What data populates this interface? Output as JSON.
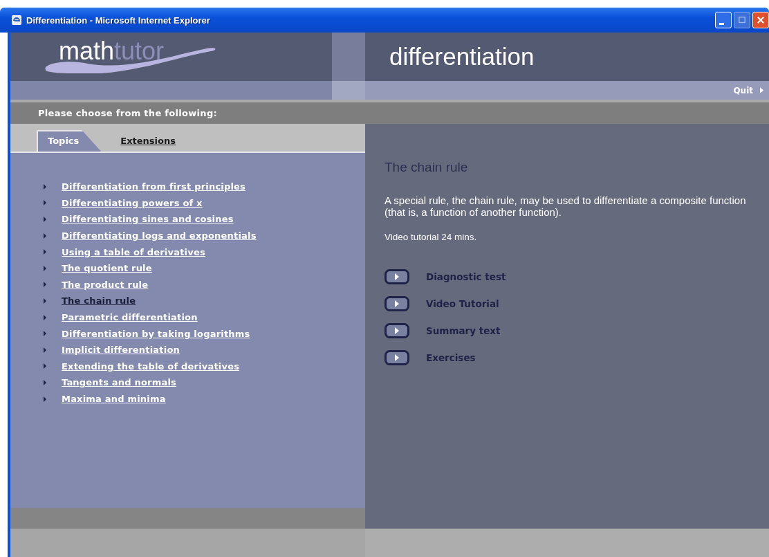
{
  "window": {
    "title": "Differentiation - Microsoft Internet Explorer"
  },
  "logo": {
    "part_1": "math",
    "part_2": "tutor"
  },
  "header": {
    "title": "differentiation",
    "quit": "Quit"
  },
  "prompt": "Please choose from the following:",
  "tabs": [
    {
      "label": "Topics",
      "selected": true
    },
    {
      "label": "Extensions",
      "selected": false
    }
  ],
  "topics": [
    {
      "label": "Differentiation from first principles",
      "selected": false
    },
    {
      "label": "Differentiating powers of x",
      "selected": false
    },
    {
      "label": "Differentiating sines and cosines",
      "selected": false
    },
    {
      "label": "Differentiating logs and exponentials",
      "selected": false
    },
    {
      "label": "Using a table of derivatives",
      "selected": false
    },
    {
      "label": "The quotient rule",
      "selected": false
    },
    {
      "label": "The product rule",
      "selected": false
    },
    {
      "label": "The chain rule",
      "selected": true
    },
    {
      "label": "Parametric differentiation",
      "selected": false
    },
    {
      "label": "Differentiation by taking logarithms",
      "selected": false
    },
    {
      "label": "Implicit differentiation",
      "selected": false
    },
    {
      "label": "Extending the table of derivatives",
      "selected": false
    },
    {
      "label": "Tangents and normals",
      "selected": false
    },
    {
      "label": "Maxima and minima",
      "selected": false
    }
  ],
  "content": {
    "title": "The chain rule",
    "description": "A special rule, the chain rule, may be used to differentiate a composite function (that is, a function of another function).",
    "duration": "Video tutorial 24 mins.",
    "actions": [
      "Diagnostic test",
      "Video Tutorial",
      "Summary text",
      "Exercises"
    ]
  }
}
